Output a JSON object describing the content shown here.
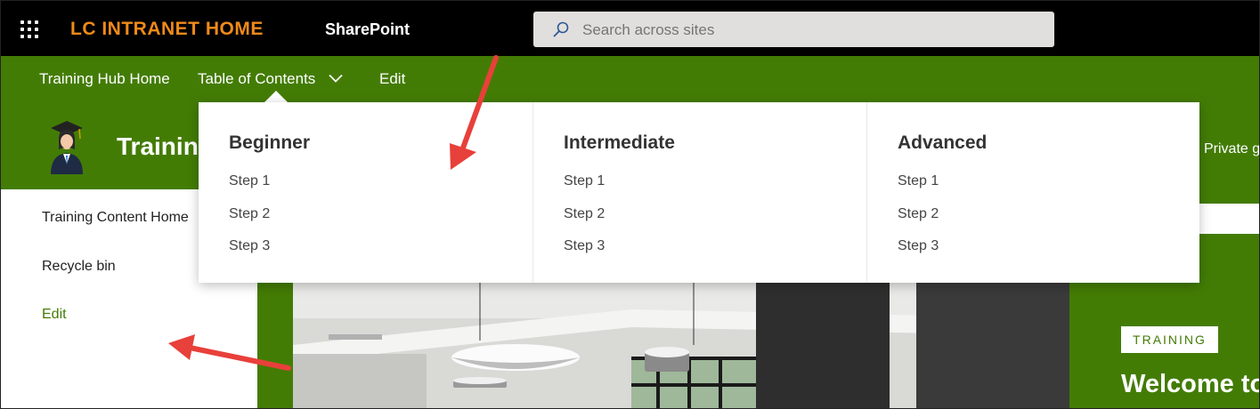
{
  "suitebar": {
    "brand": "LC INTRANET HOME",
    "app_name": "SharePoint",
    "search_placeholder": "Search across sites",
    "icons": [
      "waffle-icon",
      "search-icon"
    ]
  },
  "hubnav": {
    "items": [
      {
        "label": "Training Hub Home"
      },
      {
        "label": "Table of Contents"
      },
      {
        "label": "Edit"
      }
    ]
  },
  "site": {
    "title": "Training",
    "privacy": "Private g"
  },
  "leftnav": {
    "items": [
      {
        "label": "Training Content Home"
      },
      {
        "label": "Recycle bin"
      },
      {
        "label": "Edit"
      }
    ]
  },
  "megamenu": {
    "columns": [
      {
        "title": "Beginner",
        "links": [
          "Step 1",
          "Step 2",
          "Step 3"
        ]
      },
      {
        "title": "Intermediate",
        "links": [
          "Step 1",
          "Step 2",
          "Step 3"
        ]
      },
      {
        "title": "Advanced",
        "links": [
          "Step 1",
          "Step 2",
          "Step 3"
        ]
      }
    ]
  },
  "hero": {
    "tag": "TRAINING",
    "heading": "Welcome to"
  },
  "colors": {
    "suitebar": "#000000",
    "brand": "#f08a1a",
    "theme_green": "#437c05",
    "annotation_arrow": "#e8403a"
  }
}
